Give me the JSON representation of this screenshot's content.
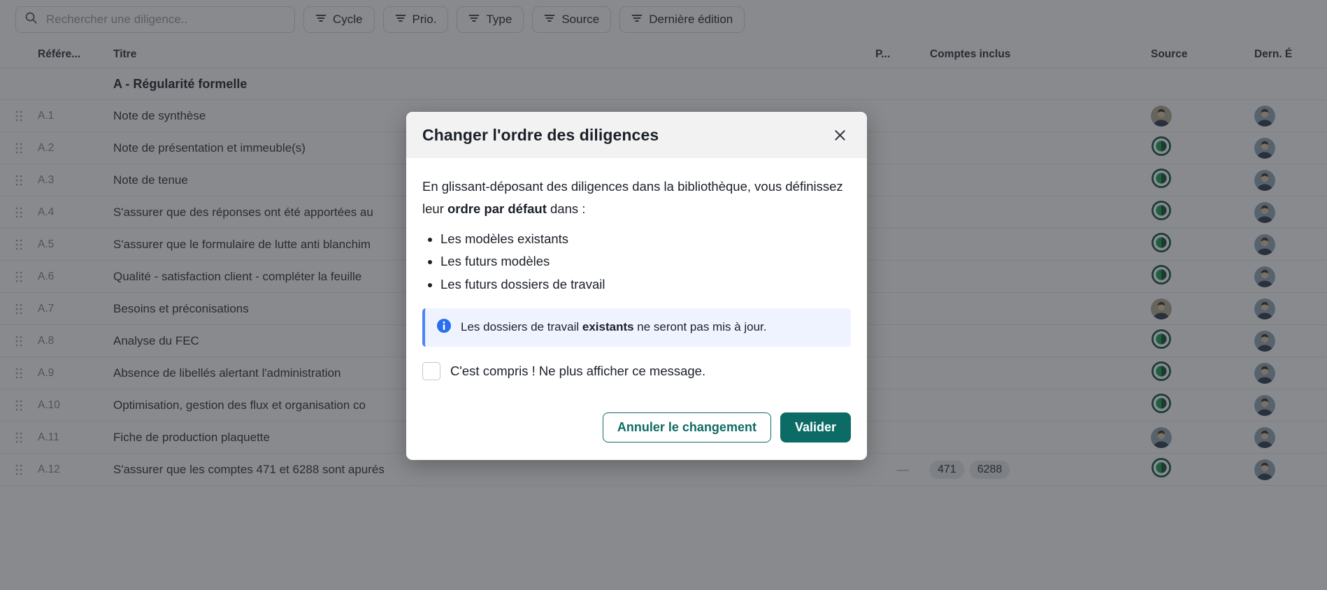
{
  "toolbar": {
    "search": {
      "placeholder": "Rechercher une diligence..",
      "value": "",
      "icon": "search-icon"
    },
    "filters": [
      {
        "label": "Cycle",
        "icon": "filter-icon"
      },
      {
        "label": "Prio.",
        "icon": "filter-icon"
      },
      {
        "label": "Type",
        "icon": "filter-icon"
      },
      {
        "label": "Source",
        "icon": "filter-icon"
      },
      {
        "label": "Dernière édition",
        "icon": "filter-icon"
      }
    ]
  },
  "table": {
    "columns": {
      "reference": "Référe...",
      "title": "Titre",
      "priority": "P...",
      "accounts": "Comptes inclus",
      "source": "Source",
      "last_edit": "Dern. É"
    },
    "group": {
      "label": "A - Régularité formelle"
    },
    "rows": [
      {
        "ref": "A.1",
        "title": "Note de synthèse",
        "priority": "",
        "accounts": [],
        "source_icon": "avatar-photo",
        "editor_icon": "avatar-photo"
      },
      {
        "ref": "A.2",
        "title": "Note de présentation et immeuble(s)",
        "priority": "",
        "accounts": [],
        "source_icon": "app-logo-icon",
        "editor_icon": "avatar-photo"
      },
      {
        "ref": "A.3",
        "title": "Note de tenue",
        "priority": "",
        "accounts": [],
        "source_icon": "app-logo-icon",
        "editor_icon": "avatar-photo"
      },
      {
        "ref": "A.4",
        "title": "S'assurer que des réponses ont été apportées au",
        "priority": "",
        "accounts": [],
        "source_icon": "app-logo-icon",
        "editor_icon": "avatar-photo"
      },
      {
        "ref": "A.5",
        "title": "S'assurer que le formulaire de lutte anti blanchim",
        "priority": "",
        "accounts": [],
        "source_icon": "app-logo-icon",
        "editor_icon": "avatar-photo"
      },
      {
        "ref": "A.6",
        "title": "Qualité - satisfaction client - compléter la feuille",
        "priority": "",
        "accounts": [],
        "source_icon": "app-logo-icon",
        "editor_icon": "avatar-photo"
      },
      {
        "ref": "A.7",
        "title": "Besoins et préconisations",
        "priority": "",
        "accounts": [],
        "source_icon": "avatar-photo",
        "editor_icon": "avatar-photo"
      },
      {
        "ref": "A.8",
        "title": "Analyse du FEC",
        "priority": "",
        "accounts": [],
        "source_icon": "app-logo-icon",
        "editor_icon": "avatar-photo"
      },
      {
        "ref": "A.9",
        "title": "Absence de libellés alertant l'administration",
        "priority": "",
        "accounts": [],
        "source_icon": "app-logo-icon",
        "editor_icon": "avatar-photo"
      },
      {
        "ref": "A.10",
        "title": "Optimisation, gestion des flux et organisation co",
        "priority": "",
        "accounts": [],
        "source_icon": "app-logo-icon",
        "editor_icon": "avatar-photo"
      },
      {
        "ref": "A.11",
        "title": "Fiche de production plaquette",
        "priority": "",
        "accounts": [],
        "source_icon": "avatar-photo",
        "editor_icon": "avatar-photo"
      },
      {
        "ref": "A.12",
        "title": "S'assurer que les comptes 471 et 6288 sont apurés",
        "priority": "—",
        "accounts": [
          "471",
          "6288"
        ],
        "source_icon": "app-logo-icon",
        "editor_icon": "avatar-photo"
      }
    ]
  },
  "dialog": {
    "title": "Changer l'ordre des diligences",
    "close_icon": "close-icon",
    "intro_part1": "En glissant-déposant des diligences dans la bibliothèque, vous définissez leur ",
    "intro_bold": "ordre par défaut",
    "intro_part2": " dans :",
    "bullets": [
      "Les modèles existants",
      "Les futurs modèles",
      "Les futurs dossiers de travail"
    ],
    "info": {
      "icon": "info-circle-icon",
      "text_part1": "Les dossiers de travail ",
      "text_bold": "existants",
      "text_part2": " ne seront pas mis à jour."
    },
    "checkbox": {
      "label": "C'est compris ! Ne plus afficher ce message.",
      "checked": false
    },
    "buttons": {
      "cancel": "Annuler le changement",
      "confirm": "Valider"
    }
  },
  "colors": {
    "accent_teal": "#0d6b66",
    "info_blue": "#4d85f5",
    "info_bg": "#eef3ff",
    "dialog_header_bg": "#f2f2f2",
    "overlay": "rgba(38,42,48,0.55)"
  }
}
